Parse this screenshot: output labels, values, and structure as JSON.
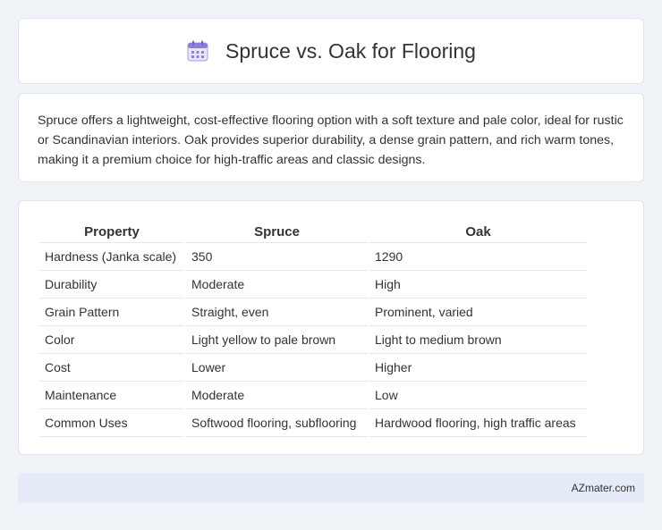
{
  "header": {
    "title": "Spruce vs. Oak for Flooring",
    "icon": "calendar-icon"
  },
  "description": "Spruce offers a lightweight, cost-effective flooring option with a soft texture and pale color, ideal for rustic or Scandinavian interiors. Oak provides superior durability, a dense grain pattern, and rich warm tones, making it a premium choice for high-traffic areas and classic designs.",
  "table": {
    "headers": [
      "Property",
      "Spruce",
      "Oak"
    ],
    "rows": [
      [
        "Hardness (Janka scale)",
        "350",
        "1290"
      ],
      [
        "Durability",
        "Moderate",
        "High"
      ],
      [
        "Grain Pattern",
        "Straight, even",
        "Prominent, varied"
      ],
      [
        "Color",
        "Light yellow to pale brown",
        "Light to medium brown"
      ],
      [
        "Cost",
        "Lower",
        "Higher"
      ],
      [
        "Maintenance",
        "Moderate",
        "Low"
      ],
      [
        "Common Uses",
        "Softwood flooring, subflooring",
        "Hardwood flooring, high traffic areas"
      ]
    ]
  },
  "footer": {
    "text": "AZmater.com"
  },
  "colors": {
    "background": "#f0f3f8",
    "footer_bg": "#e5ebf7",
    "icon_accent": "#8b7fd9"
  }
}
